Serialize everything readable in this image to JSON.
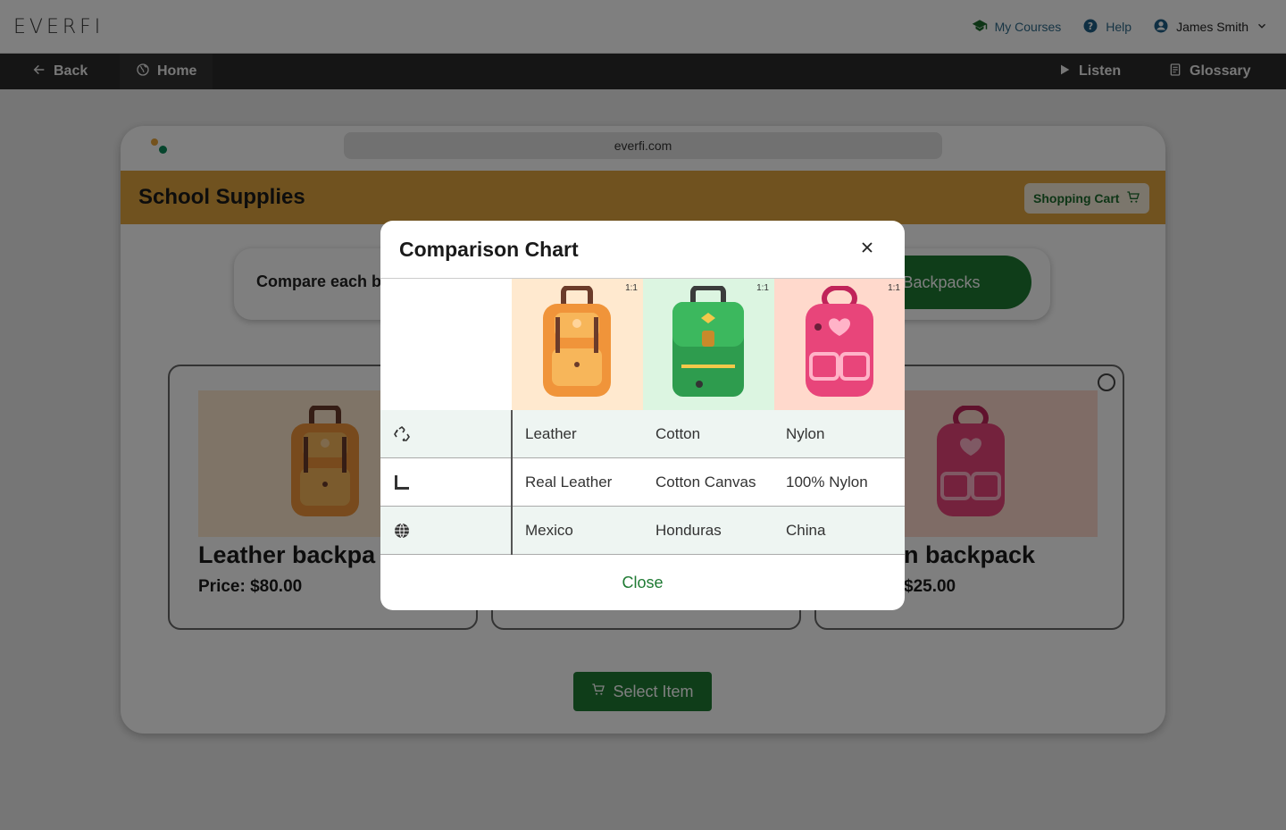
{
  "header": {
    "logo": "EVERFI",
    "my_courses": "My Courses",
    "help": "Help",
    "user_name": "James Smith"
  },
  "nav": {
    "back": "Back",
    "home": "Home",
    "listen": "Listen",
    "glossary": "Glossary"
  },
  "browser": {
    "url": "everfi.com"
  },
  "banner": {
    "title": "School Supplies",
    "cart_label": "Shopping Cart"
  },
  "instructions": {
    "text": "Compare each b",
    "compare_button": "are Backpacks"
  },
  "cards": [
    {
      "title": "Leather backpa",
      "price": "Price: $80.00"
    },
    {
      "title": "",
      "price": ""
    },
    {
      "title": "n backpack",
      "price": "$25.00"
    }
  ],
  "select_button": "Select Item",
  "modal": {
    "title": "Comparison Chart",
    "ratio_label": "1:1",
    "products": [
      {
        "color": "#f0943a"
      },
      {
        "color": "#2e9c4e"
      },
      {
        "color": "#e8457a"
      }
    ],
    "rows": [
      {
        "icon": "recycle-icon",
        "values": [
          "Leather",
          "Cotton",
          "Nylon"
        ]
      },
      {
        "icon": "ruler-icon",
        "values": [
          "Real Leather",
          "Cotton Canvas",
          "100% Nylon"
        ]
      },
      {
        "icon": "globe-icon",
        "values": [
          "Mexico",
          "Honduras",
          "China"
        ]
      }
    ],
    "close_label": "Close"
  },
  "colors": {
    "accent_green": "#1f7a33",
    "banner": "#e0a43e"
  }
}
